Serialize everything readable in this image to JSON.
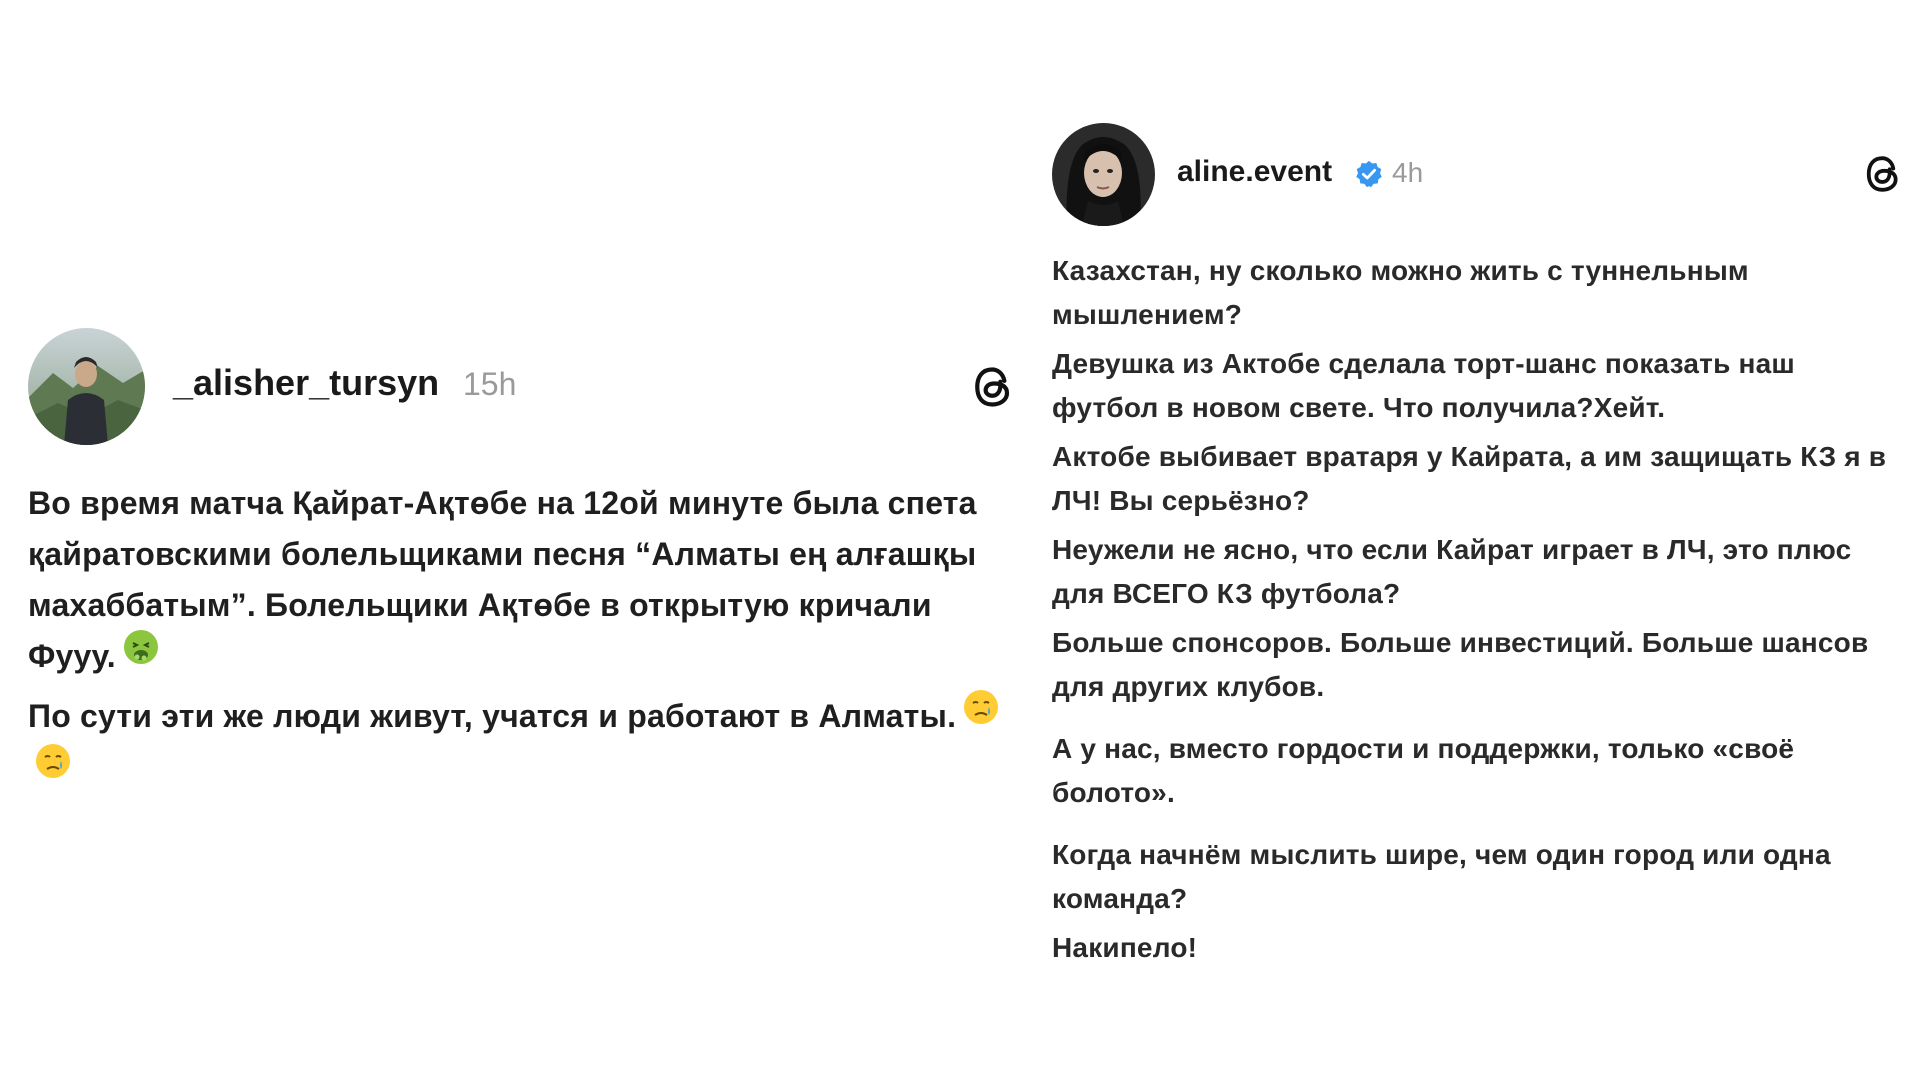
{
  "left_post": {
    "username": "_alisher_tursyn",
    "time": "15h",
    "paragraphs": [
      "Во время матча Қайрат-Ақтөбе на 12ой минуте была спета қайратовскими болельщиками песня “Алматы ең алғашқы махаббатым”. Болельщики Ақтөбе в открытую кричали Фууу.",
      "По сути эти же люди живут, учатся и работают в Алматы."
    ],
    "icons": {
      "avatar": "avatar-photo",
      "platform": "threads-icon",
      "emoji_1": "nauseated-face-emoji",
      "emoji_2": "crying-face-emoji"
    }
  },
  "right_post": {
    "username": "aline.event",
    "time": "4h",
    "paragraphs": [
      "Казахстан, ну сколько можно жить с туннельным мышлением?",
      "Девушка из Актобе сделала торт-шанс показать наш футбол в новом свете. Что получила?Хейт.",
      "Актобе выбивает вратаря у Кайрата, а им защищать КЗ я в ЛЧ! Вы серьёзно?",
      "Неужели не ясно, что если Кайрат играет в ЛЧ, это плюс для ВСЕГО КЗ футбола?",
      "Больше спонсоров. Больше инвестиций. Больше шансов для других клубов.",
      "А у нас, вместо гордости и поддержки, только «своё болото».",
      "Когда начнём мыслить шире, чем один город или одна команда?",
      "Накипело!"
    ],
    "icons": {
      "avatar": "avatar-photo",
      "verified": "verified-badge-icon",
      "platform": "threads-icon"
    },
    "colors": {
      "verified": "#3897f0"
    }
  }
}
